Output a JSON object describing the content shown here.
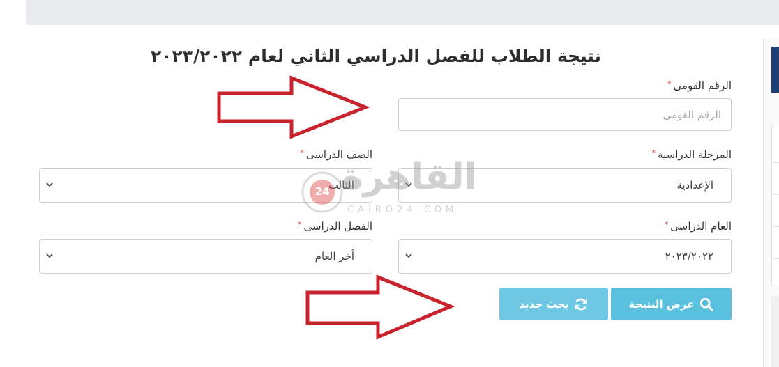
{
  "page": {
    "title": "نتيجة الطلاب للفصل الدراسي الثاني لعام ٢٠٢٣/٢٠٢٢"
  },
  "form": {
    "national_id": {
      "label": "الرقم القومى",
      "placeholder": "الرقم القومى",
      "required_mark": "*"
    },
    "stage": {
      "label": "المرحلة الدراسية",
      "value": "الإعدادية",
      "required_mark": "*"
    },
    "grade": {
      "label": "الصف الدراسى",
      "value": "الثالث",
      "required_mark": "*"
    },
    "year": {
      "label": "العام الدراسى",
      "value": "٢٠٢٣/٢٠٢٢",
      "required_mark": "*"
    },
    "term": {
      "label": "الفصل الدراسى",
      "value": "أخر العام",
      "required_mark": "*"
    }
  },
  "buttons": {
    "show_result": {
      "label": "عرض النتيجة",
      "icon": "search-icon"
    },
    "new_search": {
      "label": "بحث جديد",
      "icon": "refresh-icon"
    }
  },
  "watermark": {
    "arabic": "القاهرة",
    "latin": "CAIRO24.COM",
    "badge": "24"
  },
  "colors": {
    "button": "#5bc0de",
    "arrow": "#c8232c",
    "required": "#d9534f",
    "sidebar_accent": "#1e3f73"
  }
}
